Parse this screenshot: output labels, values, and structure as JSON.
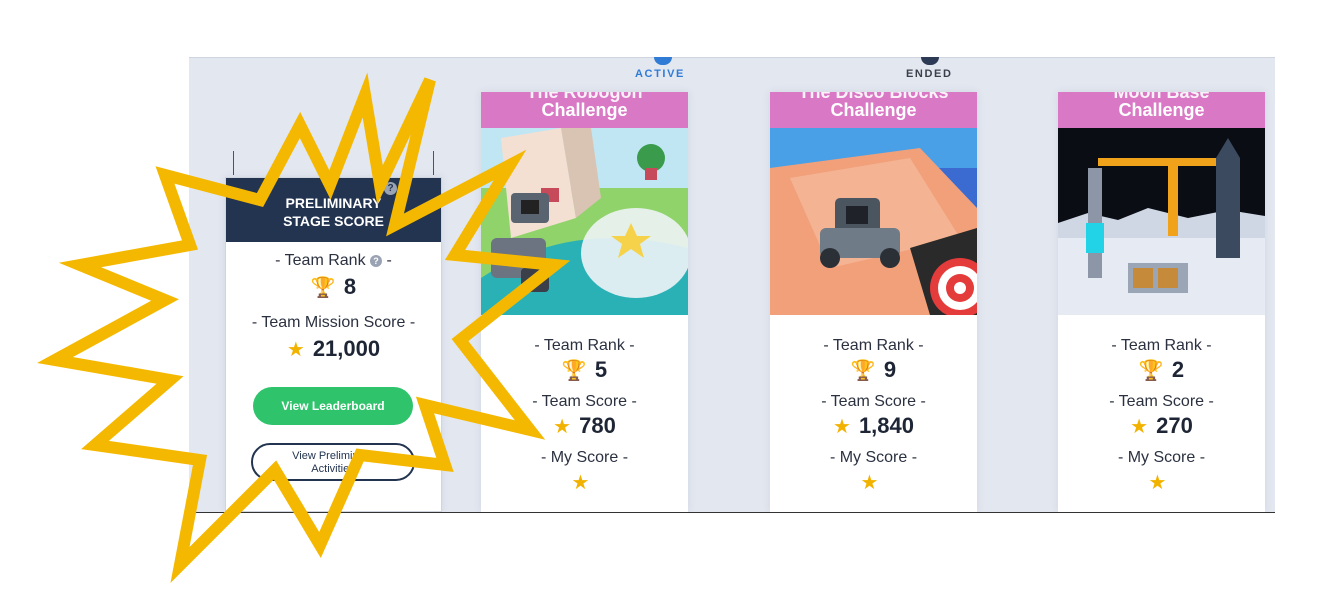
{
  "status": {
    "active": "ACTIVE",
    "ended": "ENDED"
  },
  "preliminary": {
    "title_line1": "PRELIMINARY",
    "title_line2": "STAGE SCORE",
    "rank_label": "- Team Rank",
    "rank_suffix": "-",
    "rank_value": "8",
    "mission_label": "- Team Mission Score -",
    "mission_value": "21,000",
    "leaderboard_button": "View Leaderboard",
    "activities_button_line1": "View Preliminary",
    "activities_button_line2": "Activities"
  },
  "challenges": [
    {
      "title_top": "The Robogon",
      "title": "Challenge",
      "rank_label": "- Team Rank -",
      "rank": "5",
      "score_label": "- Team Score -",
      "score": "780",
      "my_label": "- My Score -"
    },
    {
      "title_top": "The Disco Blocks",
      "title": "Challenge",
      "rank_label": "- Team Rank -",
      "rank": "9",
      "score_label": "- Team Score -",
      "score": "1,840",
      "my_label": "- My Score -"
    },
    {
      "title_top": "Moon Base",
      "title": "Challenge",
      "rank_label": "- Team Rank -",
      "rank": "2",
      "score_label": "- Team Score -",
      "score": "270",
      "my_label": "- My Score -"
    }
  ],
  "colors": {
    "accent_green": "#2fc46c",
    "header_navy": "#233450",
    "challenge_pink": "#d978c4",
    "burst_yellow": "#f5b800"
  }
}
